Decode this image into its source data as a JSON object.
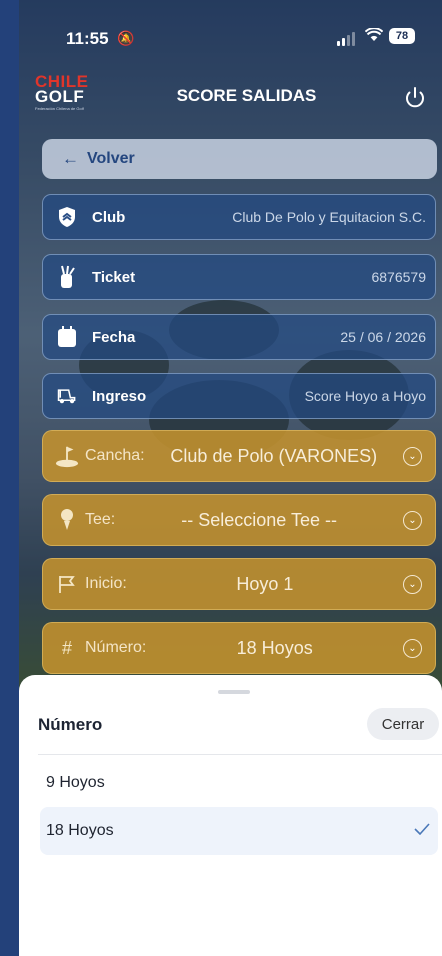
{
  "status_bar": {
    "time": "11:55",
    "battery": "78"
  },
  "header": {
    "logo_top": "CHILE",
    "logo_bottom": "GOLF",
    "logo_sub": "Federación Chilena de Golf",
    "title": "SCORE SALIDAS"
  },
  "back": {
    "label": "Volver"
  },
  "info_rows": [
    {
      "label": "Club",
      "value": "Club De Polo y Equitacion S.C."
    },
    {
      "label": "Ticket",
      "value": "6876579"
    },
    {
      "label": "Fecha",
      "value": "25 / 06 / 2026"
    },
    {
      "label": "Ingreso",
      "value": "Score Hoyo a Hoyo"
    }
  ],
  "selectors": [
    {
      "label": "Cancha:",
      "value": "Club de Polo (VARONES)"
    },
    {
      "label": "Tee:",
      "value": "-- Seleccione Tee --"
    },
    {
      "label": "Inicio:",
      "value": "Hoyo 1"
    },
    {
      "label": "Número:",
      "value": "18 Hoyos"
    }
  ],
  "sheet": {
    "title": "Número",
    "close_label": "Cerrar",
    "options": [
      {
        "label": "9 Hoyos",
        "selected": false
      },
      {
        "label": "18 Hoyos",
        "selected": true
      }
    ]
  },
  "colors": {
    "accent_blue": "#224a82",
    "gold": "#c4922d",
    "check": "#4a78b8"
  }
}
